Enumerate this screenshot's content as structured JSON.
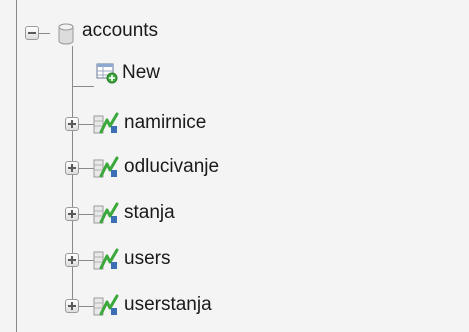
{
  "tree": {
    "database": {
      "label": "accounts",
      "expanded": true,
      "icon": "database-icon"
    },
    "new_item": {
      "label": "New",
      "icon": "new-table-icon"
    },
    "tables": [
      {
        "label": "namirnice",
        "icon": "table-icon"
      },
      {
        "label": "odlucivanje",
        "icon": "table-icon"
      },
      {
        "label": "stanja",
        "icon": "table-icon"
      },
      {
        "label": "users",
        "icon": "table-icon"
      },
      {
        "label": "userstanja",
        "icon": "table-icon"
      }
    ]
  },
  "colors": {
    "background": "#f4f4f4",
    "line": "#8a8a8a",
    "table_icon_green": "#3aa83a",
    "table_icon_blue": "#3a6fb5"
  }
}
